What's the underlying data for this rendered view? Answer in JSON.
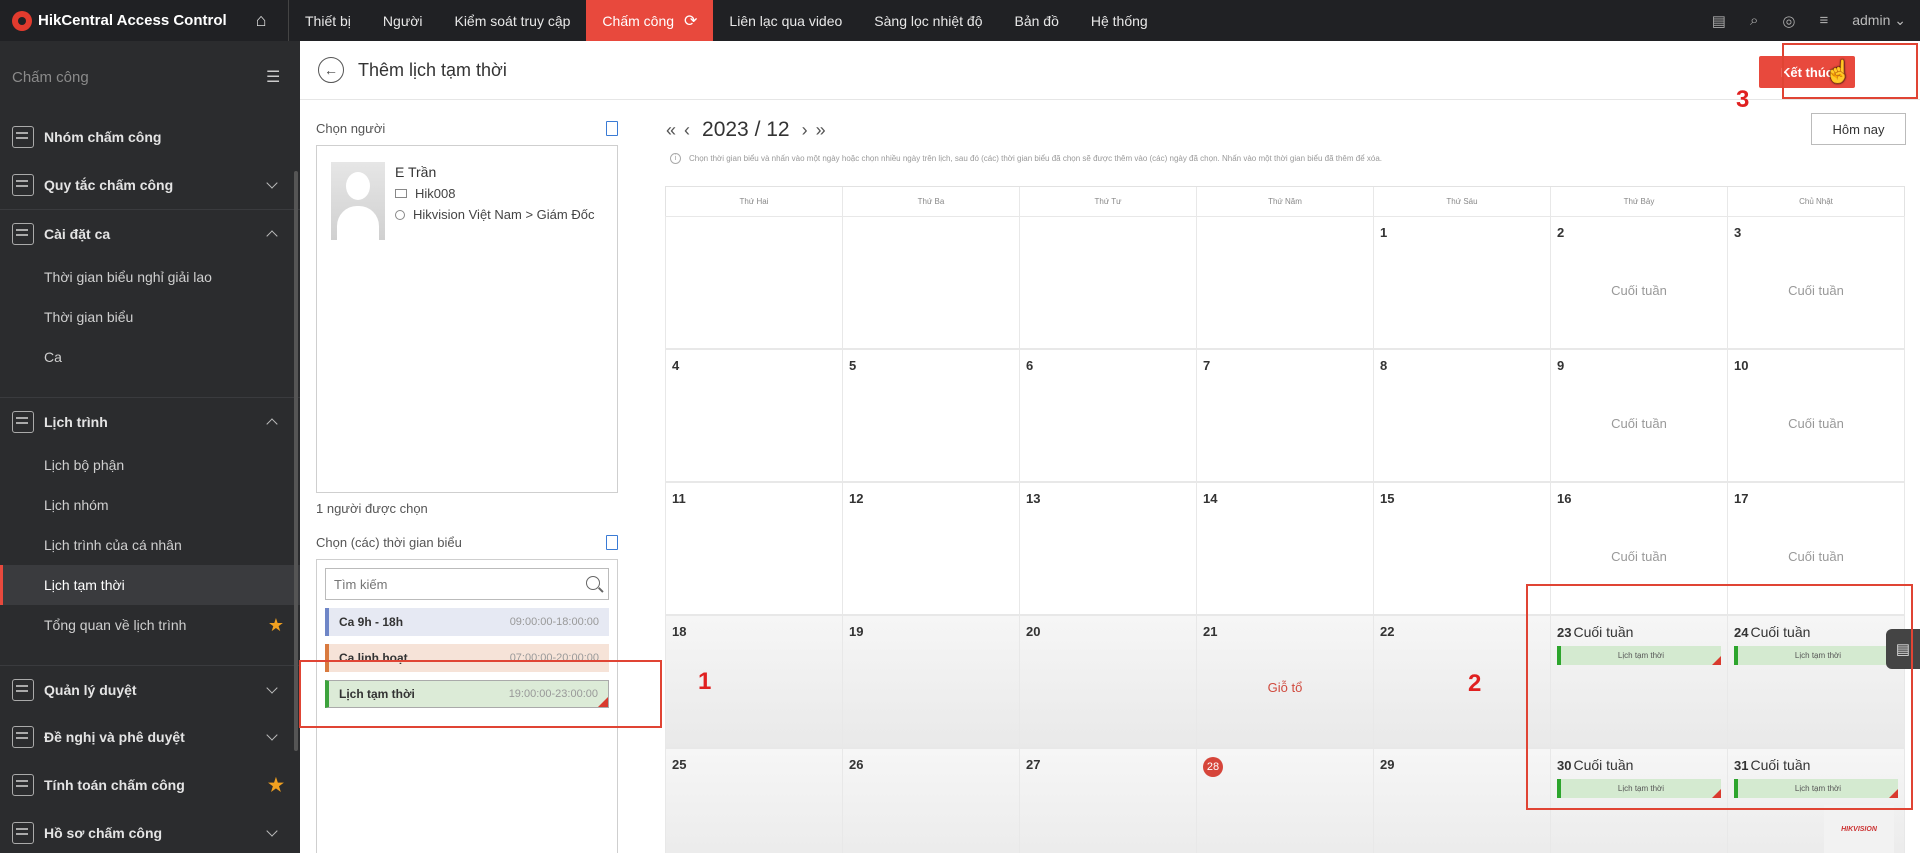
{
  "app": {
    "title": "HikCentral Access Control",
    "user": "admin"
  },
  "nav": [
    {
      "label": "Thiết bị"
    },
    {
      "label": "Người"
    },
    {
      "label": "Kiểm soát truy cập"
    },
    {
      "label": "Chấm công",
      "active": true
    },
    {
      "label": "Liên lạc qua video"
    },
    {
      "label": "Sàng lọc nhiệt độ"
    },
    {
      "label": "Bản đồ"
    },
    {
      "label": "Hệ thống"
    }
  ],
  "sidebar": {
    "title": "Chấm công",
    "groups": {
      "nhom_cham_cong": "Nhóm chấm công",
      "quy_tac": "Quy tắc chấm công",
      "cai_dat_ca": "Cài đặt ca",
      "cai_dat_ca_items": [
        "Thời gian biểu nghỉ giải lao",
        "Thời gian biểu",
        "Ca"
      ],
      "lich_trinh": "Lịch trình",
      "lich_trinh_items": [
        "Lịch bộ phận",
        "Lịch nhóm",
        "Lịch trình của cá nhân",
        "Lịch tạm thời",
        "Tổng quan về lịch trình"
      ],
      "quan_ly_duyet": "Quản lý duyệt",
      "de_nghi": "Đề nghị và phê duyệt",
      "tinh_toan": "Tính toán chấm công",
      "ho_so": "Hồ sơ chấm công"
    }
  },
  "page": {
    "title": "Thêm lịch tạm thời",
    "finish_label": "Kết thúc",
    "today_label": "Hôm nay"
  },
  "person_section": {
    "title": "Chọn người",
    "name": "E Trần",
    "id": "Hik008",
    "org": "Hikvision Việt Nam > Giám Đốc",
    "count_text": "1 người được chọn"
  },
  "schedule_section": {
    "title": "Chọn (các) thời gian biểu",
    "search_placeholder": "Tìm kiếm",
    "shifts": [
      {
        "name": "Ca 9h - 18h",
        "time": "09:00:00-18:00:00",
        "color": "#6f86c7"
      },
      {
        "name": "Ca linh hoạt",
        "time": "07:00:00-20:00:00",
        "color": "#d97a3f"
      },
      {
        "name": "Lịch tạm thời",
        "time": "19:00:00-23:00:00",
        "color": "#3da33d"
      }
    ]
  },
  "calendar": {
    "year_month": "2023 / 12",
    "hint": "Chọn thời gian biểu và nhấn vào một ngày hoặc chọn nhiều ngày trên lịch, sau đó (các) thời gian biểu đã chọn sẽ được thêm vào (các) ngày đã chọn. Nhấn vào một thời gian biểu đã thêm để xóa.",
    "weekdays": [
      "Thứ Hai",
      "Thứ Ba",
      "Thứ Tư",
      "Thứ Năm",
      "Thứ Sáu",
      "Thứ Bảy",
      "Chủ Nhật"
    ],
    "weekend_label": "Cuối tuần",
    "holiday_label": "Giỗ tổ",
    "tag_label": "Lịch tạm thời",
    "weeks": [
      [
        "",
        "",
        "",
        "",
        "1",
        "2",
        "3"
      ],
      [
        "4",
        "5",
        "6",
        "7",
        "8",
        "9",
        "10"
      ],
      [
        "11",
        "12",
        "13",
        "14",
        "15",
        "16",
        "17"
      ],
      [
        "18",
        "19",
        "20",
        "21",
        "22",
        "23",
        "24"
      ],
      [
        "25",
        "26",
        "27",
        "28",
        "29",
        "30",
        "31"
      ]
    ]
  },
  "annotations": {
    "one": "1",
    "two": "2",
    "three": "3"
  },
  "colors": {
    "accent": "#e8493d",
    "annotation": "#e04434",
    "tag_green": "#2da52d"
  }
}
